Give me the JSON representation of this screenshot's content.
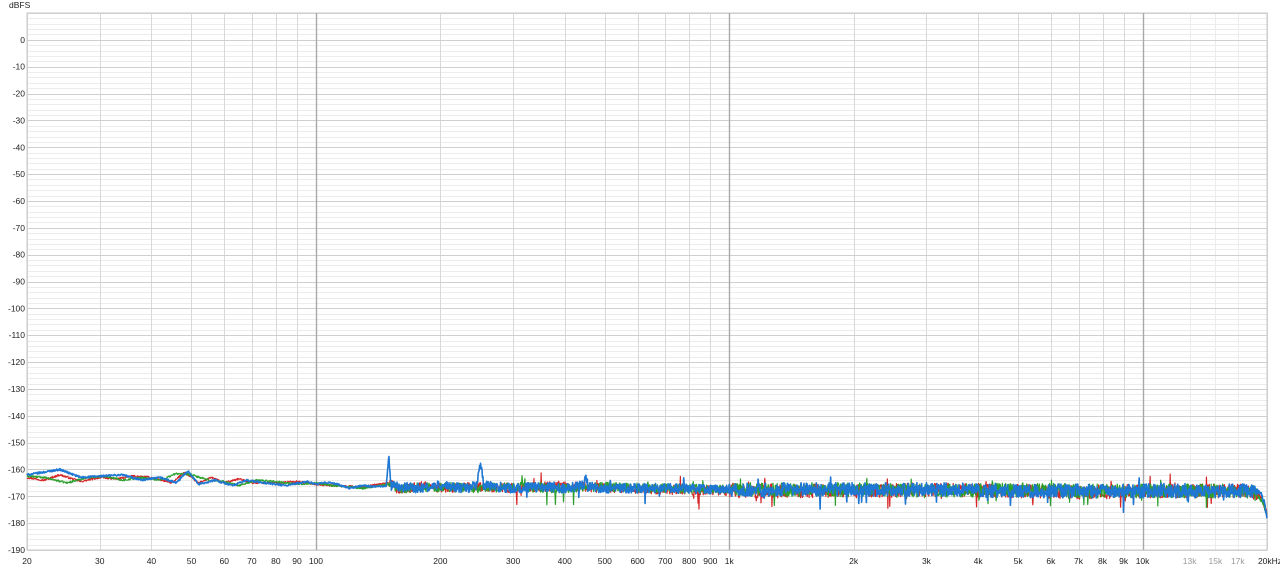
{
  "chart_data": {
    "type": "line",
    "title": "",
    "ylabel": "dBFS",
    "xlabel": "",
    "x_scale": "log",
    "xlim": [
      20,
      20000
    ],
    "ylim": [
      -190,
      10
    ],
    "y_ticks": [
      0,
      -10,
      -20,
      -30,
      -40,
      -50,
      -60,
      -70,
      -80,
      -90,
      -100,
      -110,
      -120,
      -130,
      -140,
      -150,
      -160,
      -170,
      -180,
      -190
    ],
    "y_tick_labels": [
      "0",
      "-10",
      "-20",
      "-30",
      "-40",
      "-50",
      "-60",
      "-70",
      "-80",
      "-90",
      "-100",
      "-110",
      "-120",
      "-130",
      "-140",
      "-150",
      "-160",
      "-170",
      "-180",
      "-190"
    ],
    "x_ticks": [
      {
        "f": 20,
        "label": "20",
        "minor": false
      },
      {
        "f": 30,
        "label": "30",
        "minor": false
      },
      {
        "f": 40,
        "label": "40",
        "minor": false
      },
      {
        "f": 50,
        "label": "50",
        "minor": false
      },
      {
        "f": 60,
        "label": "60",
        "minor": false
      },
      {
        "f": 70,
        "label": "70",
        "minor": false
      },
      {
        "f": 80,
        "label": "80",
        "minor": false
      },
      {
        "f": 90,
        "label": "90",
        "minor": false
      },
      {
        "f": 100,
        "label": "100",
        "minor": false
      },
      {
        "f": 200,
        "label": "200",
        "minor": false
      },
      {
        "f": 300,
        "label": "300",
        "minor": false
      },
      {
        "f": 400,
        "label": "400",
        "minor": false
      },
      {
        "f": 500,
        "label": "500",
        "minor": false
      },
      {
        "f": 600,
        "label": "600",
        "minor": false
      },
      {
        "f": 700,
        "label": "700",
        "minor": false
      },
      {
        "f": 800,
        "label": "800",
        "minor": false
      },
      {
        "f": 900,
        "label": "900",
        "minor": false
      },
      {
        "f": 1000,
        "label": "1k",
        "minor": false
      },
      {
        "f": 2000,
        "label": "2k",
        "minor": false
      },
      {
        "f": 3000,
        "label": "3k",
        "minor": false
      },
      {
        "f": 4000,
        "label": "4k",
        "minor": false
      },
      {
        "f": 5000,
        "label": "5k",
        "minor": false
      },
      {
        "f": 6000,
        "label": "6k",
        "minor": false
      },
      {
        "f": 7000,
        "label": "7k",
        "minor": false
      },
      {
        "f": 8000,
        "label": "8k",
        "minor": false
      },
      {
        "f": 9000,
        "label": "9k",
        "minor": false
      },
      {
        "f": 10000,
        "label": "10k",
        "minor": false
      },
      {
        "f": 13000,
        "label": "13k",
        "minor": true
      },
      {
        "f": 15000,
        "label": "15k",
        "minor": true
      },
      {
        "f": 17000,
        "label": "17k",
        "minor": true
      },
      {
        "f": 20000,
        "label": "20kHz",
        "minor": false
      }
    ],
    "grid": true,
    "legend": "none",
    "series": [
      {
        "color": "#d62728",
        "points": [
          [
            20,
            -163
          ],
          [
            22,
            -164
          ],
          [
            24,
            -162
          ],
          [
            27,
            -164.5
          ],
          [
            30,
            -163
          ],
          [
            33,
            -163.5
          ],
          [
            36,
            -162.5
          ],
          [
            40,
            -163
          ],
          [
            45,
            -165
          ],
          [
            48,
            -161
          ],
          [
            52,
            -165
          ],
          [
            56,
            -163
          ],
          [
            60,
            -165
          ],
          [
            65,
            -163.5
          ],
          [
            70,
            -165
          ],
          [
            80,
            -165
          ],
          [
            90,
            -164.5
          ],
          [
            100,
            -165.5
          ],
          [
            110,
            -166
          ],
          [
            130,
            -166.5
          ],
          [
            150,
            -165
          ],
          [
            160,
            -168
          ],
          [
            180,
            -166
          ],
          [
            200,
            -167
          ],
          [
            250,
            -166.5
          ],
          [
            300,
            -167
          ],
          [
            400,
            -166
          ],
          [
            500,
            -167
          ],
          [
            700,
            -167.5
          ],
          [
            1000,
            -168
          ],
          [
            2000,
            -168
          ],
          [
            3000,
            -167.5
          ],
          [
            5000,
            -168
          ],
          [
            7000,
            -168.5
          ],
          [
            10000,
            -168
          ],
          [
            13000,
            -168
          ],
          [
            15000,
            -168
          ],
          [
            17000,
            -168
          ],
          [
            18500,
            -168
          ],
          [
            19500,
            -171
          ],
          [
            20000,
            -177
          ]
        ]
      },
      {
        "color": "#2ca02c",
        "points": [
          [
            20,
            -162.5
          ],
          [
            22,
            -163
          ],
          [
            25,
            -165
          ],
          [
            28,
            -163
          ],
          [
            31,
            -162.5
          ],
          [
            34,
            -164
          ],
          [
            38,
            -163
          ],
          [
            42,
            -164
          ],
          [
            46,
            -161.5
          ],
          [
            50,
            -162
          ],
          [
            55,
            -164
          ],
          [
            60,
            -164.5
          ],
          [
            65,
            -166
          ],
          [
            72,
            -164
          ],
          [
            80,
            -164.5
          ],
          [
            90,
            -165.5
          ],
          [
            100,
            -165
          ],
          [
            110,
            -166
          ],
          [
            130,
            -167
          ],
          [
            150,
            -165.5
          ],
          [
            160,
            -167
          ],
          [
            200,
            -166.5
          ],
          [
            250,
            -167
          ],
          [
            300,
            -166.5
          ],
          [
            400,
            -167
          ],
          [
            500,
            -166.5
          ],
          [
            700,
            -167
          ],
          [
            1000,
            -167.5
          ],
          [
            2000,
            -167.5
          ],
          [
            3000,
            -168
          ],
          [
            5000,
            -167.5
          ],
          [
            7000,
            -168
          ],
          [
            10000,
            -168
          ],
          [
            13000,
            -168
          ],
          [
            15000,
            -168
          ],
          [
            17000,
            -168
          ],
          [
            18500,
            -168.5
          ],
          [
            19500,
            -171.5
          ],
          [
            20000,
            -177
          ]
        ]
      },
      {
        "color": "#1f77d4",
        "points": [
          [
            20,
            -162
          ],
          [
            22,
            -161
          ],
          [
            24,
            -160
          ],
          [
            27,
            -163
          ],
          [
            30,
            -162.5
          ],
          [
            34,
            -162
          ],
          [
            38,
            -164
          ],
          [
            42,
            -163
          ],
          [
            46,
            -165
          ],
          [
            49,
            -160.5
          ],
          [
            52,
            -165.5
          ],
          [
            57,
            -164
          ],
          [
            63,
            -166
          ],
          [
            68,
            -164
          ],
          [
            75,
            -165
          ],
          [
            85,
            -166
          ],
          [
            95,
            -164.5
          ],
          [
            100,
            -165.5
          ],
          [
            105,
            -165
          ],
          [
            110,
            -165
          ],
          [
            120,
            -167
          ],
          [
            130,
            -166
          ],
          [
            140,
            -166.5
          ],
          [
            148,
            -166
          ],
          [
            150,
            -155.5
          ],
          [
            152,
            -166
          ],
          [
            160,
            -166.5
          ],
          [
            180,
            -167
          ],
          [
            200,
            -166
          ],
          [
            230,
            -167
          ],
          [
            245,
            -166
          ],
          [
            250,
            -158
          ],
          [
            255,
            -166
          ],
          [
            300,
            -167
          ],
          [
            350,
            -166.5
          ],
          [
            400,
            -167
          ],
          [
            445,
            -166
          ],
          [
            450,
            -161.5
          ],
          [
            455,
            -166.5
          ],
          [
            500,
            -167
          ],
          [
            700,
            -167
          ],
          [
            1000,
            -167.5
          ],
          [
            2000,
            -167.5
          ],
          [
            3000,
            -167.5
          ],
          [
            5000,
            -168
          ],
          [
            7000,
            -168
          ],
          [
            10000,
            -168
          ],
          [
            13000,
            -168
          ],
          [
            15000,
            -168
          ],
          [
            17000,
            -168
          ],
          [
            18500,
            -168
          ],
          [
            19300,
            -169
          ],
          [
            19700,
            -172
          ],
          [
            20000,
            -178
          ]
        ]
      }
    ]
  }
}
